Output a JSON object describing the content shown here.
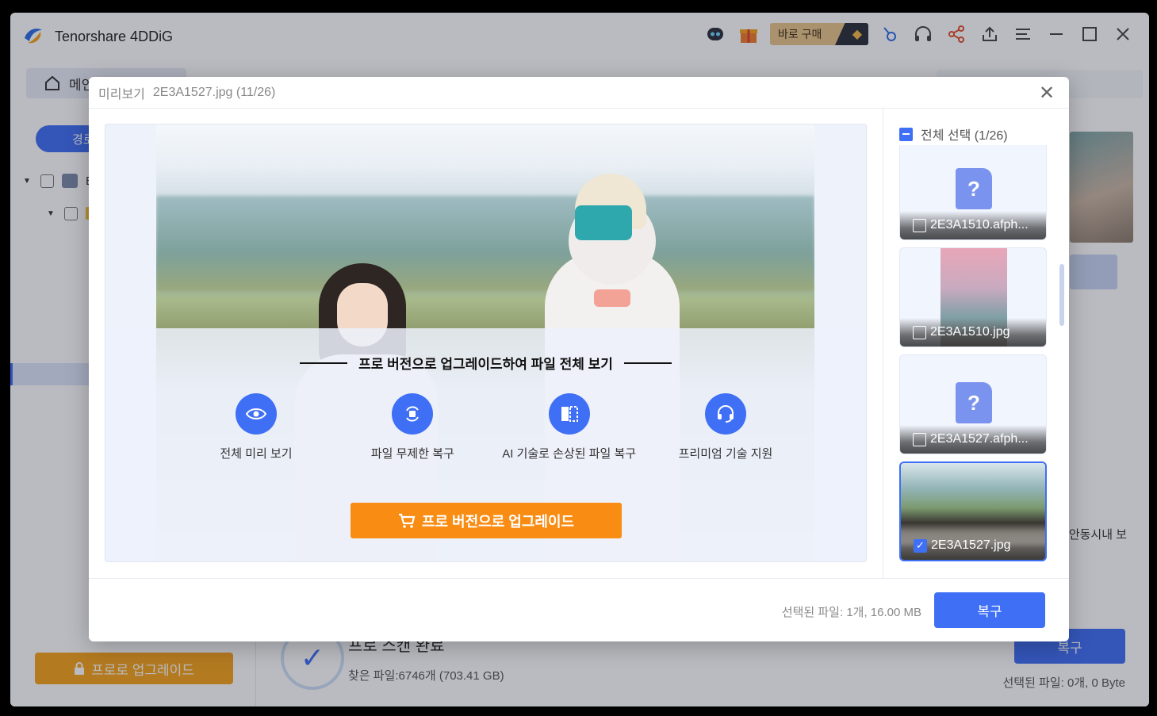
{
  "app": {
    "title": "Tenorshare 4DDiG",
    "buy_label": "바로 구매",
    "home_tab_label": "메인",
    "path_label": "경로"
  },
  "sidebar": {
    "upgrade_label": "프로로 업그레이드",
    "tree_first_label": "E"
  },
  "main": {
    "scan_done": "프로 스캔 완료",
    "found_files": "찾은 파일:6746개 (703.41 GB)",
    "recover_label": "복구",
    "selected_info": "선택된 파일: 0개, 0 Byte",
    "side_text": "안동시내 보"
  },
  "modal": {
    "header_label": "미리보기",
    "filename": "2E3A1527.jpg (11/26)",
    "promo_title": "프로 버전으로 업그레이드하여 파일 전체 보기",
    "features": [
      {
        "label": "전체 미리 보기",
        "icon": "eye-icon"
      },
      {
        "label": "파일 무제한 복구",
        "icon": "restore-icon"
      },
      {
        "label": "AI 기술로 손상된 파일 복구",
        "icon": "ai-repair-icon"
      },
      {
        "label": "프리미엄 기술 지원",
        "icon": "headset-icon"
      }
    ],
    "upgrade_button": "프로 버전으로 업그레이드",
    "select_all": "전체 선택 (1/26)",
    "thumbnails": [
      {
        "name": "2E3A1510.afph...",
        "checked": false,
        "kind": "unknown"
      },
      {
        "name": "2E3A1510.jpg",
        "checked": false,
        "kind": "image"
      },
      {
        "name": "2E3A1527.afph...",
        "checked": false,
        "kind": "unknown"
      },
      {
        "name": "2E3A1527.jpg",
        "checked": true,
        "kind": "image"
      }
    ],
    "footer_info": "선택된 파일: 1개, 16.00 MB",
    "footer_recover": "복구"
  },
  "colors": {
    "accent": "#3f6ff5",
    "upgrade_orange": "#f98c12",
    "side_upgrade": "#f5a31b"
  }
}
